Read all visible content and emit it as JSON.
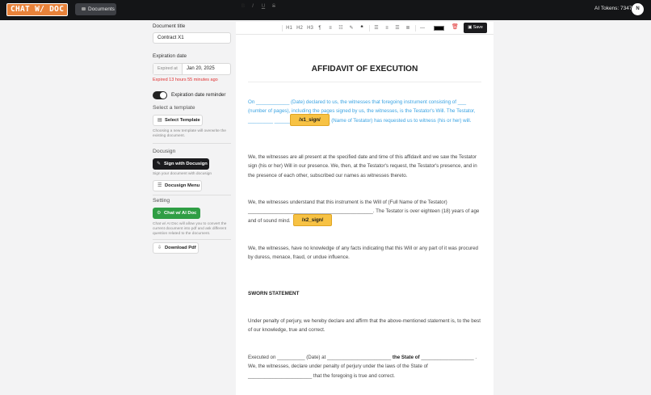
{
  "header": {
    "logo": "CHAT W/ DOC",
    "documents_label": "Documents",
    "ai_tokens": "AI Tokens: 7347",
    "avatar_initial": "N"
  },
  "sidebar": {
    "doc_title_label": "Document title",
    "doc_title_value": "Contract X1",
    "expiration_label": "Expiration date",
    "expiration_prefix": "Expired at",
    "expiration_value": "Jan 20, 2025",
    "expired_msg": "Expired 13 hours 55 minutes ago",
    "reminder_label": "Expiration date reminder",
    "reminder_on": true,
    "template_heading": "Select a template",
    "select_template_label": "Select Template",
    "template_note": "Choosing a new template will overwrite the existing document.",
    "docusign_heading": "Docusign",
    "sign_docusign_label": "Sign with Docusign",
    "docusign_note": "Sign your document with docusign",
    "docusign_menu_label": "Docusign Menu",
    "setting_heading": "Setting",
    "chat_label": "Chat w/ AI Doc",
    "chat_note": "Chat w/ AI Doc will allow you to convert the current document into pdf and ask different question related to the document.",
    "download_label": "Download Pdf"
  },
  "toolbar": {
    "bold": "B",
    "italic": "I",
    "underline": "U",
    "strike": "S",
    "h1": "H1",
    "h2": "H2",
    "h3": "H3",
    "save_label": "Save",
    "text_color": "#000000"
  },
  "document": {
    "title": "AFFIDAVIT OF EXECUTION",
    "p1": "On ____________ (Date) declared to us, the witnesses that foregoing instrument consisting of ___ (number of pages), including the pages signed by us, the witnesses, is the Testator's Will. The Testator, _________ ____________________ (Name of Testator) has requested us to witness (his or her) will.",
    "sig1": "/x1_sign/",
    "p2": "We, the witnesses are all present at the specified date and time of this affidavit and we saw the Testator sign (his or her) Will in our presence. We, then, at the Testator's request, the Testator's presence, and in the presence of each other, subscribed our names as witnesses thereto.",
    "p3": "We, the witnesses understand that this instrument is the Will of (Full Name of the Testator) _____________________________________________. The Testator is over eighteen (18) years of age and of sound mind.",
    "sig2": "/x2_sign/",
    "p4": "We, the witnesses, have no knowledge of any facts indicating that this Will or any part of it was procured by duress, menace, fraud, or undue influence.",
    "heading": "SWORN STATEMENT",
    "p5": "Under penalty of perjury, we hereby declare and affirm that the above-mentioned statement is, to the best of our knowledge, true and correct.",
    "p6_a": "Executed on __________ (Date) at _______________________ ",
    "p6_b": "the State of",
    "p6_c": " ___________________ . We, the witnesses, declare under penalty of perjury under the laws of the State of _______________________ that the foregoing is true and correct."
  },
  "colors": {
    "accent_blue": "#3aa3e3",
    "signature_yellow": "#f7c244",
    "error_red": "#e03131",
    "chat_green": "#2f9e44"
  }
}
